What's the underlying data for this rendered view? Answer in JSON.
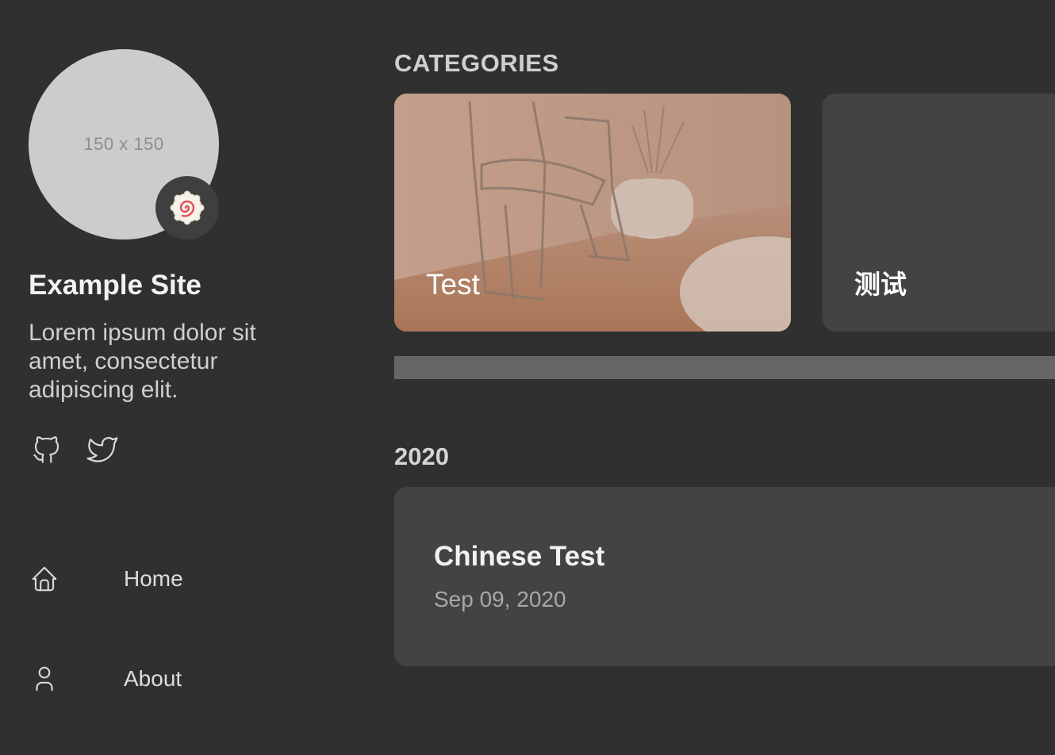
{
  "sidebar": {
    "avatar_placeholder": "150 x 150",
    "site_title": "Example Site",
    "site_description": "Lorem ipsum dolor sit amet, consectetur adipiscing elit.",
    "social": [
      {
        "icon": "github-icon"
      },
      {
        "icon": "twitter-icon"
      }
    ],
    "menu": [
      {
        "icon": "home-icon",
        "label": "Home"
      },
      {
        "icon": "user-icon",
        "label": "About"
      }
    ]
  },
  "main": {
    "categories_heading": "CATEGORIES",
    "categories": [
      {
        "name": "Test",
        "image": "chair-photo"
      },
      {
        "name": "测试"
      }
    ],
    "archive": {
      "year": "2020",
      "posts": [
        {
          "title": "Chinese Test",
          "date": "Sep 09, 2020"
        }
      ]
    }
  },
  "colors": {
    "background": "#303030",
    "card": "#434343",
    "scrollbar": "#666666"
  }
}
